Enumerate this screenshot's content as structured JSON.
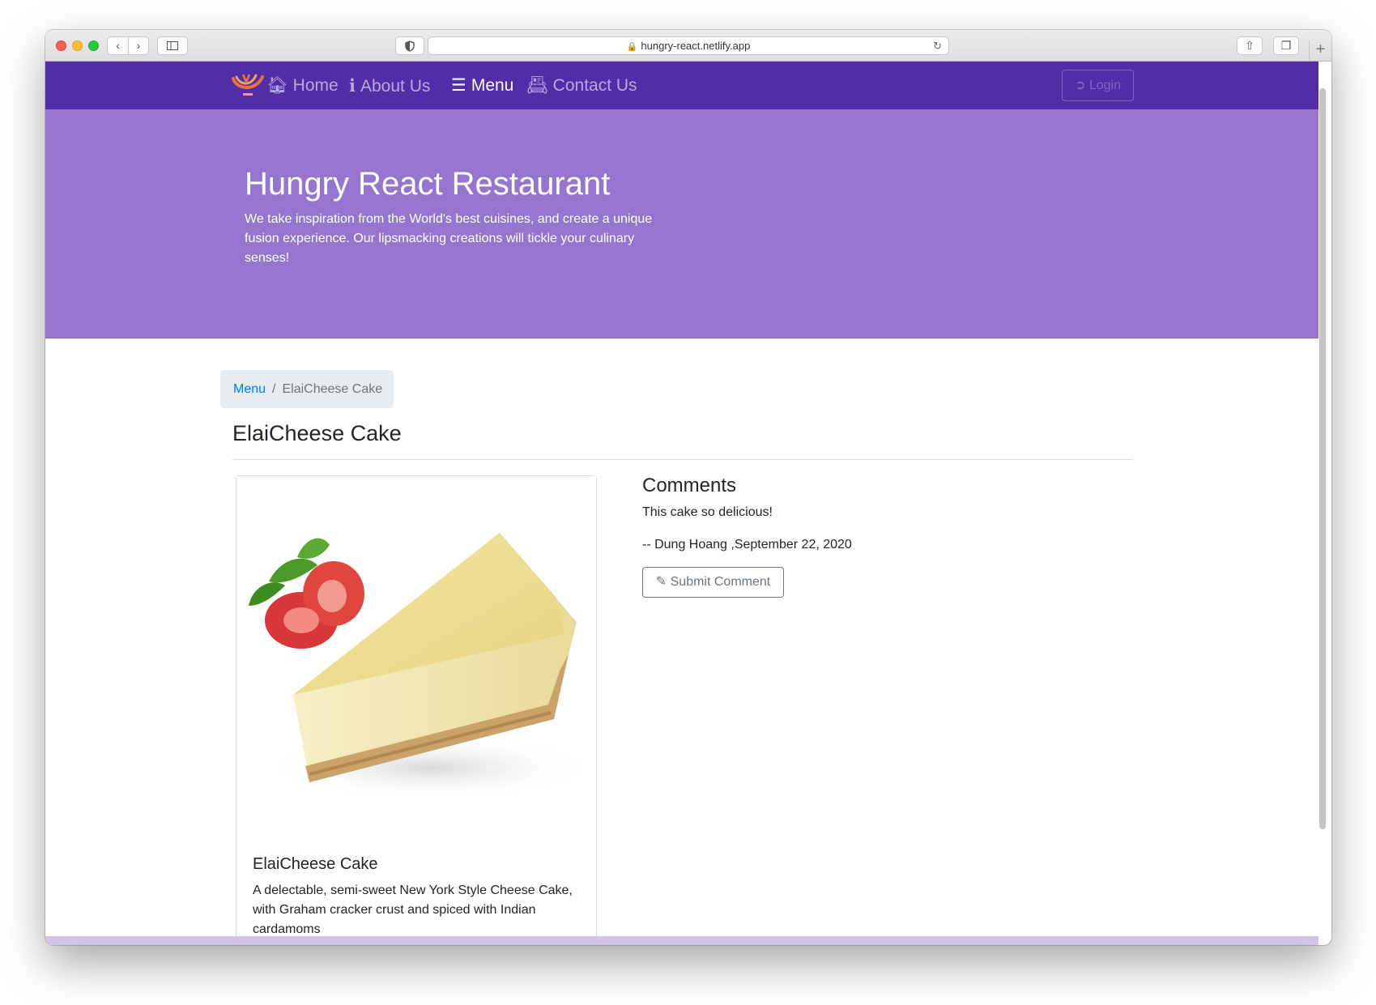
{
  "browser": {
    "url": "hungry-react.netlify.app"
  },
  "navbar": {
    "items": [
      {
        "label": "Home",
        "icon": "home-icon"
      },
      {
        "label": "About Us",
        "icon": "info-icon"
      },
      {
        "label": "Menu",
        "icon": "list-icon",
        "active": true
      },
      {
        "label": "Contact Us",
        "icon": "address-card-icon"
      }
    ],
    "login_label": "Login"
  },
  "jumbotron": {
    "title": "Hungry React Restaurant",
    "text": "We take inspiration from the World's best cuisines, and create a unique fusion experience. Our lipsmacking creations will tickle your culinary senses!"
  },
  "breadcrumb": {
    "parent": "Menu",
    "current": "ElaiCheese Cake"
  },
  "page": {
    "title": "ElaiCheese Cake"
  },
  "dish": {
    "name": "ElaiCheese Cake",
    "description": "A delectable, semi-sweet New York Style Cheese Cake, with Graham cracker crust and spiced with Indian cardamoms"
  },
  "comments": {
    "heading": "Comments",
    "items": [
      {
        "text": "This cake so delicious!",
        "meta": "-- Dung Hoang ,September 22, 2020"
      }
    ],
    "submit_label": "Submit Comment"
  },
  "colors": {
    "navbar": "#512da8",
    "jumbotron": "#9575cd",
    "footer": "#d1c4e9",
    "link": "#007bff"
  }
}
